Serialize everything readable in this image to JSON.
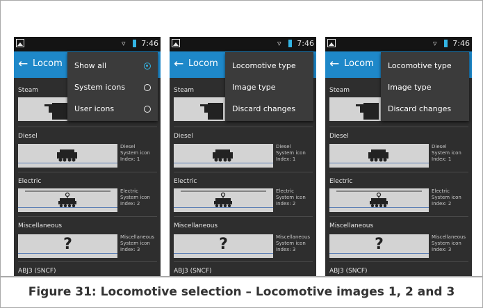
{
  "caption": "Figure 31: Locomotive selection – Locomotive images 1, 2 and 3",
  "status_time": "7:46",
  "app_title": "Locom",
  "app_title_full": "Locomotive",
  "sections": [
    {
      "label": "Steam",
      "info": [
        "",
        "",
        ""
      ]
    },
    {
      "label": "Diesel",
      "info": [
        "Diesel",
        "System icon",
        "Index: 1"
      ]
    },
    {
      "label": "Electric",
      "info": [
        "Electric",
        "System icon",
        "Index: 2"
      ]
    },
    {
      "label": "Miscellaneous",
      "info": [
        "Miscellaneous",
        "System icon",
        "Index: 3"
      ]
    }
  ],
  "misc_glyph": "?",
  "footer_item": "ABJ3 (SNCF)",
  "screens": [
    {
      "menu": {
        "type": "radio",
        "items": [
          {
            "label": "Show all",
            "checked": true
          },
          {
            "label": "System icons",
            "checked": false
          },
          {
            "label": "User icons",
            "checked": false
          }
        ]
      }
    },
    {
      "menu": {
        "type": "list",
        "items": [
          {
            "label": "Locomotive type"
          },
          {
            "label": "Image type"
          },
          {
            "label": "Discard changes"
          }
        ]
      }
    },
    {
      "menu": {
        "type": "list",
        "items": [
          {
            "label": "Locomotive type"
          },
          {
            "label": "Image type"
          },
          {
            "label": "Discard changes"
          }
        ]
      }
    }
  ],
  "colors": {
    "accent": "#1e88c9",
    "background": "#2e2e2e",
    "menu": "#3b3b3b",
    "radio_selected": "#33b5e5"
  }
}
